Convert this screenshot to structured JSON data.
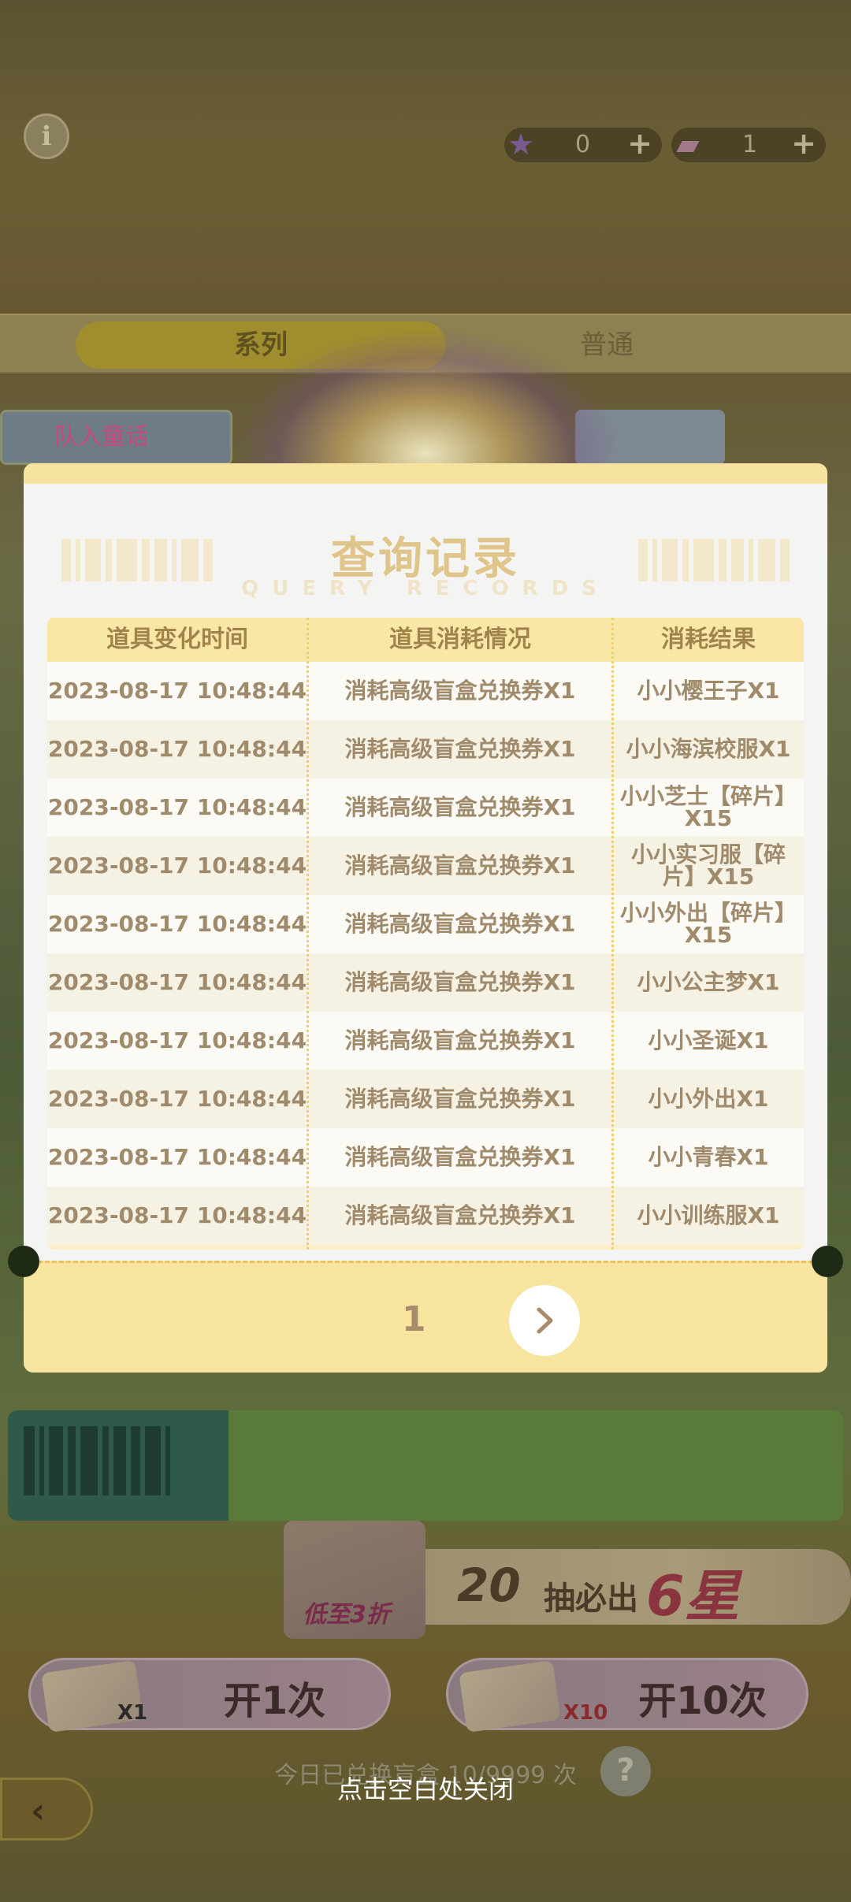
{
  "background": {
    "info_icon": "i",
    "currencies": [
      {
        "icon": "star-icon",
        "value": "0"
      },
      {
        "icon": "ticket-icon",
        "value": "1"
      }
    ],
    "tabs": {
      "series": "系列",
      "normal": "普通"
    },
    "banner_left_text": "队入童话",
    "promo": {
      "discount": "低至3折",
      "count": "20",
      "text": "抽必出",
      "star": "6星"
    },
    "buttons": {
      "one": {
        "mult": "X1",
        "label": "开1次"
      },
      "ten": {
        "mult": "X10",
        "label": "开10次"
      }
    },
    "today_count": "今日已兑换盲盒 10/9999 次",
    "help_icon": "?"
  },
  "modal": {
    "title": "查询记录",
    "subtitle": "QUERY RECORDS",
    "columns": [
      "道具变化时间",
      "道具消耗情况",
      "消耗结果"
    ],
    "rows": [
      [
        "2023-08-17 10:48:44",
        "消耗高级盲盒兑换券X1",
        "小小樱王子X1"
      ],
      [
        "2023-08-17 10:48:44",
        "消耗高级盲盒兑换券X1",
        "小小海滨校服X1"
      ],
      [
        "2023-08-17 10:48:44",
        "消耗高级盲盒兑换券X1",
        "小小芝士【碎片】X15"
      ],
      [
        "2023-08-17 10:48:44",
        "消耗高级盲盒兑换券X1",
        "小小实习服【碎片】X15"
      ],
      [
        "2023-08-17 10:48:44",
        "消耗高级盲盒兑换券X1",
        "小小外出【碎片】X15"
      ],
      [
        "2023-08-17 10:48:44",
        "消耗高级盲盒兑换券X1",
        "小小公主梦X1"
      ],
      [
        "2023-08-17 10:48:44",
        "消耗高级盲盒兑换券X1",
        "小小圣诞X1"
      ],
      [
        "2023-08-17 10:48:44",
        "消耗高级盲盒兑换券X1",
        "小小外出X1"
      ],
      [
        "2023-08-17 10:48:44",
        "消耗高级盲盒兑换券X1",
        "小小青春X1"
      ],
      [
        "2023-08-17 10:48:44",
        "消耗高级盲盒兑换券X1",
        "小小训练服X1"
      ]
    ],
    "page": "1"
  },
  "close_hint": "点击空白处关闭"
}
